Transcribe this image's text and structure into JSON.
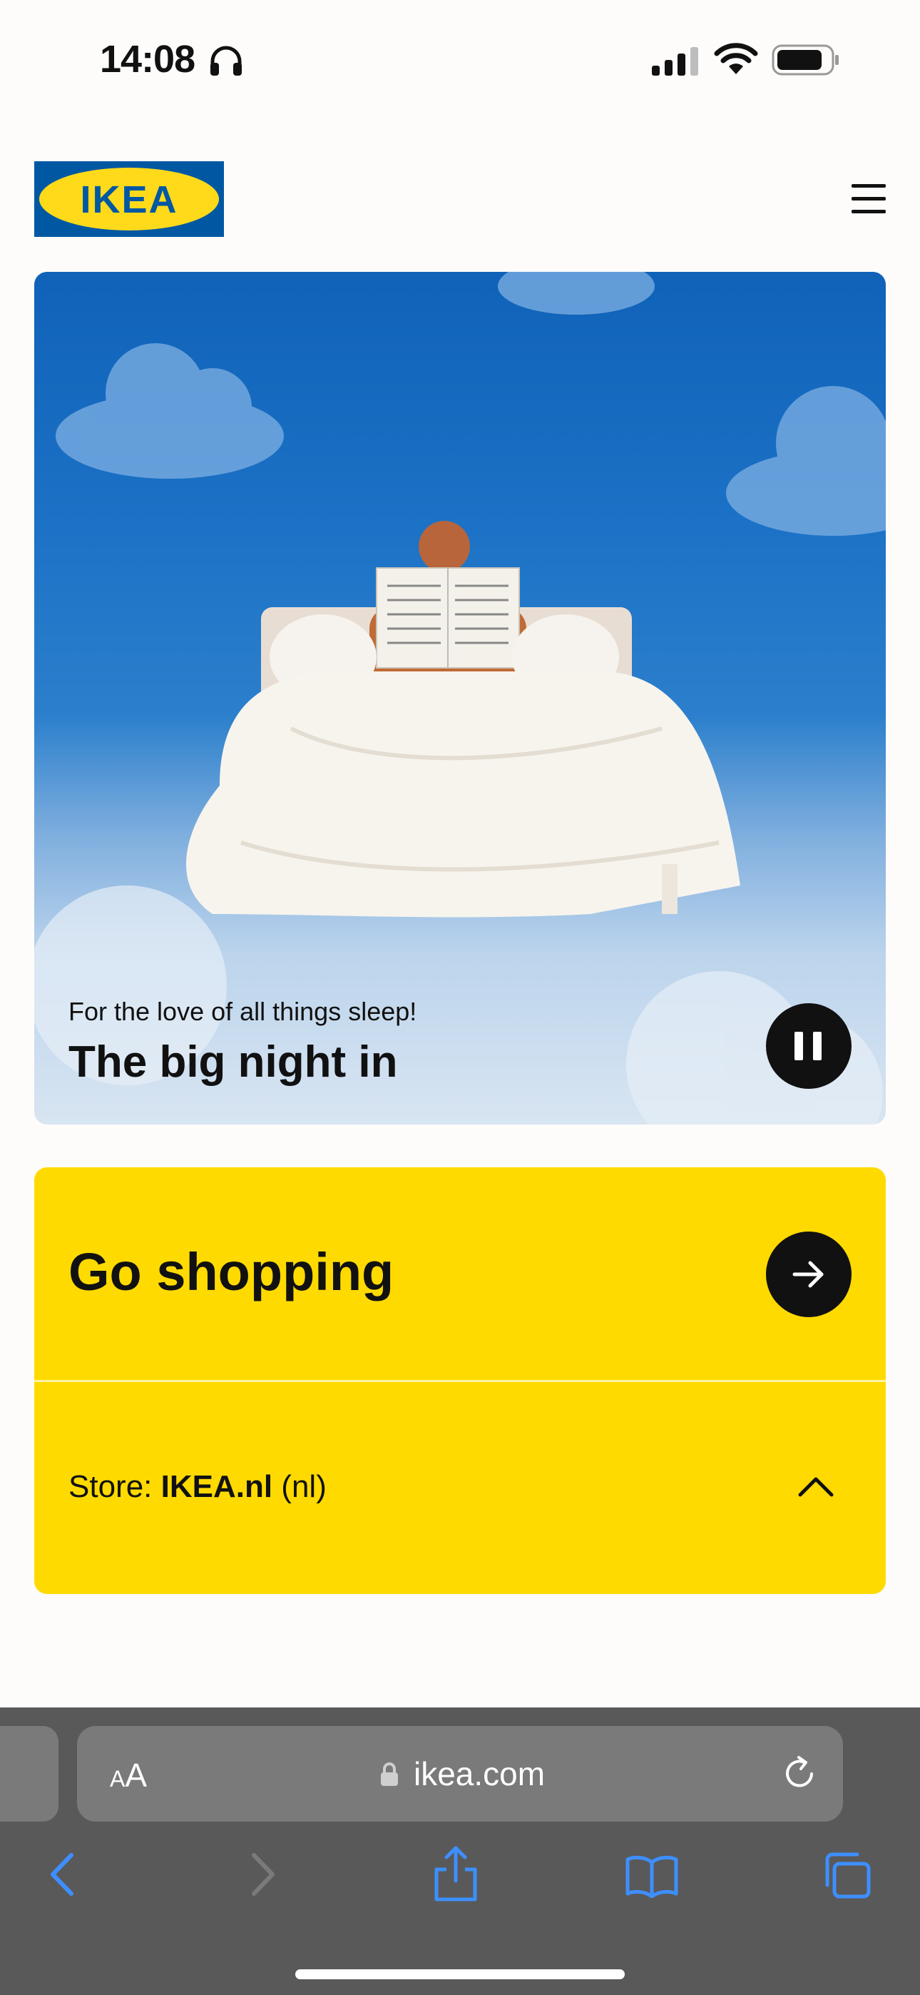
{
  "status_bar": {
    "time": "14:08",
    "icons": [
      "headphones-icon",
      "cellular-signal-icon",
      "wifi-icon",
      "battery-icon"
    ]
  },
  "header": {
    "logo_text": "IKEA",
    "logo_colors": {
      "background": "#0058a3",
      "oval": "#ffda1a",
      "text": "#0058a3"
    },
    "menu_icon": "hamburger-menu-icon"
  },
  "hero": {
    "subtitle": "For the love of all things sleep!",
    "title": "The big night in",
    "image_description_icon": "bed-in-sky-image",
    "pause_icon": "pause-icon"
  },
  "shop_card": {
    "title": "Go shopping",
    "arrow_icon": "arrow-right-icon",
    "store_label": "Store: ",
    "store_name": "IKEA.nl",
    "store_lang": " (nl)",
    "expand_icon": "chevron-up-icon",
    "accent_color": "#ffda00"
  },
  "browser": {
    "text_size_label_small": "A",
    "text_size_label_large": "A",
    "url": "ikea.com",
    "icons": [
      "lock-icon",
      "reload-icon",
      "back-icon",
      "forward-icon",
      "share-icon",
      "bookmarks-icon",
      "tabs-icon"
    ],
    "accent_color": "#3d8fff"
  }
}
